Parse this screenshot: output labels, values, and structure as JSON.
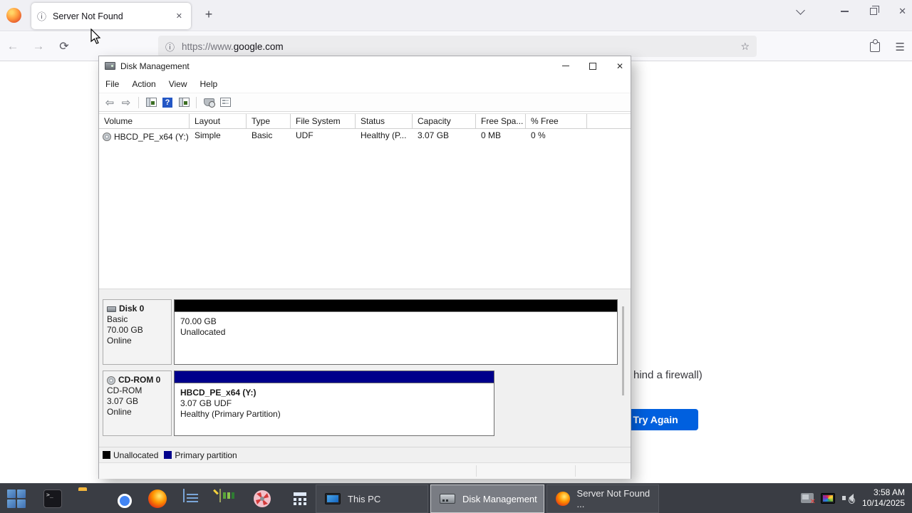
{
  "colors": {
    "accent_blue": "#0060df",
    "unallocated_black": "#000000",
    "primary_partition_navy": "#00008b",
    "taskbar_bg": "#3a3d44"
  },
  "icons": {
    "info": "ⓘ",
    "close": "✕",
    "plus": "+",
    "back": "←",
    "forward": "→",
    "reload": "⟳",
    "star": "☆",
    "menu": "☰",
    "dm_back": "⇦",
    "dm_forward": "⇨",
    "help": "?",
    "mute_slash": "⊘"
  },
  "browser": {
    "tab_title": "Server Not Found",
    "url_scheme": "https://www.",
    "url_domain": "google.com",
    "error_fragment": "hind a firewall)",
    "try_again_label": "Try Again"
  },
  "disk_management": {
    "window_title": "Disk Management",
    "menus": [
      "File",
      "Action",
      "View",
      "Help"
    ],
    "columns": [
      "Volume",
      "Layout",
      "Type",
      "File System",
      "Status",
      "Capacity",
      "Free Spa...",
      "% Free"
    ],
    "volume_row": {
      "volume": "HBCD_PE_x64 (Y:)",
      "layout": "Simple",
      "type": "Basic",
      "file_system": "UDF",
      "status": "Healthy (P...",
      "capacity": "3.07 GB",
      "free_space": "0 MB",
      "pct_free": "0 %"
    },
    "disk0": {
      "name": "Disk 0",
      "kind": "Basic",
      "size": "70.00 GB",
      "state": "Online",
      "part_line1": "70.00 GB",
      "part_line2": "Unallocated"
    },
    "cdrom0": {
      "name": "CD-ROM 0",
      "kind": "CD-ROM",
      "size": "3.07 GB",
      "state": "Online",
      "part_title": "HBCD_PE_x64  (Y:)",
      "part_line2": "3.07 GB UDF",
      "part_line3": "Healthy (Primary Partition)"
    },
    "legend": {
      "unallocated": "Unallocated",
      "primary": "Primary partition"
    }
  },
  "taskbar": {
    "this_pc_label": "This PC",
    "disk_management_label": "Disk Management",
    "server_not_found_label": "Server Not Found ...",
    "tray_time": "3:58 AM",
    "tray_date": "10/14/2025"
  }
}
